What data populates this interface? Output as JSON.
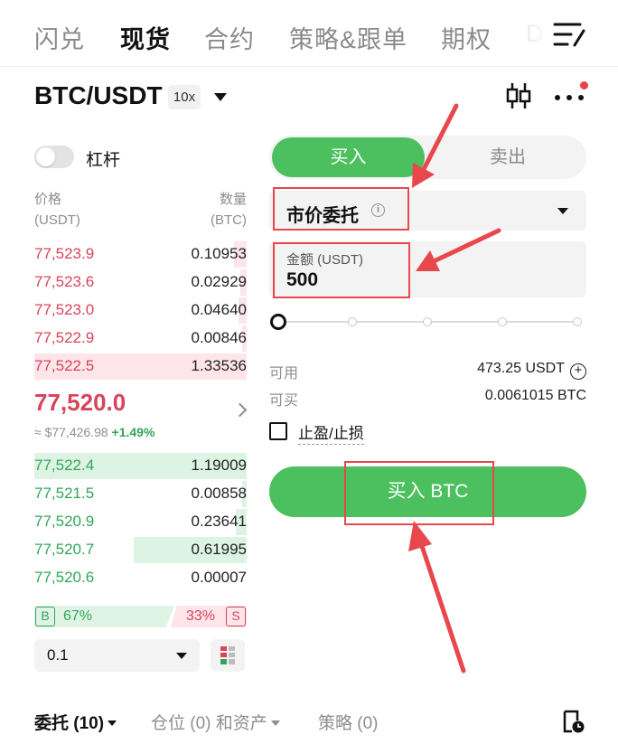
{
  "top_tabs": [
    {
      "label": "闪兑"
    },
    {
      "label": "现货"
    },
    {
      "label": "合约"
    },
    {
      "label": "策略&跟单"
    },
    {
      "label": "期权"
    },
    {
      "label": "D"
    }
  ],
  "header": {
    "pair": "BTC/USDT",
    "leverage_badge": "10x"
  },
  "margin": {
    "label": "杠杆",
    "enabled": false
  },
  "order_book": {
    "price_header": "价格",
    "price_unit": "(USDT)",
    "qty_header": "数量",
    "qty_unit": "(BTC)",
    "asks": [
      {
        "price": "77,523.9",
        "qty": "0.10953",
        "depth": 0.06
      },
      {
        "price": "77,523.6",
        "qty": "0.02929",
        "depth": 0.03
      },
      {
        "price": "77,523.0",
        "qty": "0.04640",
        "depth": 0.04
      },
      {
        "price": "77,522.9",
        "qty": "0.00846",
        "depth": 0.02
      },
      {
        "price": "77,522.5",
        "qty": "1.33536",
        "depth": 1.0
      }
    ],
    "last_price": "77,520.0",
    "ref_price": "≈ $77,426.98",
    "change": "+1.49%",
    "bids": [
      {
        "price": "77,522.4",
        "qty": "1.19009",
        "depth": 1.0
      },
      {
        "price": "77,521.5",
        "qty": "0.00858",
        "depth": 0.02
      },
      {
        "price": "77,520.9",
        "qty": "0.23641",
        "depth": 0.05
      },
      {
        "price": "77,520.7",
        "qty": "0.61995",
        "depth": 0.53
      },
      {
        "price": "77,520.6",
        "qty": "0.00007",
        "depth": 0.0
      }
    ],
    "ratio": {
      "buy_label": "B",
      "buy_pct": "67%",
      "sell_pct": "33%",
      "sell_label": "S"
    },
    "precision": "0.1"
  },
  "trade_panel": {
    "buy_tab": "买入",
    "sell_tab": "卖出",
    "order_type": "市价委托",
    "amount_label": "金额 (USDT)",
    "amount_value": "500",
    "slider_percent": 0,
    "available_label": "可用",
    "available_value": "473.25 USDT",
    "buyable_label": "可买",
    "buyable_value": "0.0061015 BTC",
    "tpsl_label": "止盈/止损",
    "submit_label": "买入 BTC"
  },
  "bottom_tabs": [
    {
      "label": "委托 (10)"
    },
    {
      "label": "仓位 (0) 和资产"
    },
    {
      "label": "策略 (0)"
    }
  ],
  "colors": {
    "buy_green": "#4cbf5f",
    "bid_green_text": "#31a65a",
    "ask_red_text": "#d9445a",
    "annotation_red": "#e8474c"
  }
}
